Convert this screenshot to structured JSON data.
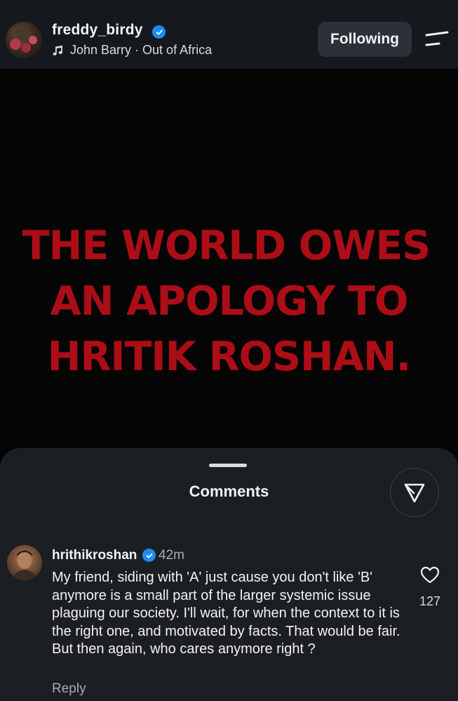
{
  "header": {
    "username": "freddy_birdy",
    "music_artist": "John Barry",
    "music_separator": " · ",
    "music_track": "Out of Africa",
    "follow_label": "Following"
  },
  "post": {
    "headline_lines": [
      "THE WORLD OWES",
      "AN APOLOGY TO",
      "HRITIK ROSHAN."
    ],
    "headline_color": "#ad0d17"
  },
  "comments_sheet": {
    "title": "Comments",
    "comment": {
      "username": "hrithikroshan",
      "time": "42m",
      "text": "My friend, siding with 'A' just cause you don't like 'B' anymore is a small part of the larger systemic issue plaguing our society.  I'll wait, for when the context to it is the right one, and motivated by facts. That would be fair. But then again, who cares anymore right ?",
      "likes": "127",
      "reply_label": "Reply"
    }
  },
  "colors": {
    "accent_verified": "#1d8cf2",
    "sheet_bg": "#1b1e23",
    "header_bg": "#15181d"
  }
}
